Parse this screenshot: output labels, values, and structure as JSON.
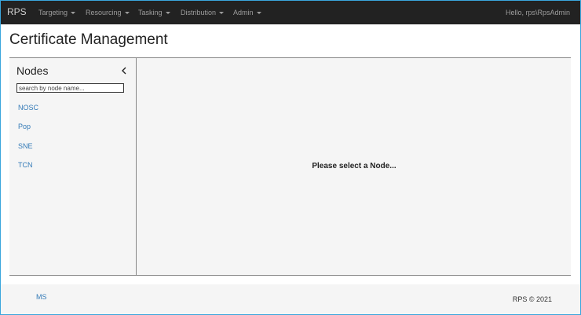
{
  "navbar": {
    "brand": "RPS",
    "menus": [
      {
        "label": "Targeting"
      },
      {
        "label": "Resourcing"
      },
      {
        "label": "Tasking"
      },
      {
        "label": "Distribution"
      },
      {
        "label": "Admin"
      }
    ],
    "greeting": "Hello, rps\\RpsAdmin"
  },
  "page": {
    "title": "Certificate Management"
  },
  "sidebar": {
    "heading": "Nodes",
    "collapse_icon": "chevron-left-icon",
    "search_placeholder": "search by node name...",
    "nodes": [
      {
        "label": "NOSC"
      },
      {
        "label": "Pop"
      },
      {
        "label": "SNE"
      },
      {
        "label": "TCN"
      }
    ]
  },
  "main": {
    "empty_message": "Please select a Node..."
  },
  "footer": {
    "link": "MS",
    "copyright": "RPS © 2021"
  }
}
